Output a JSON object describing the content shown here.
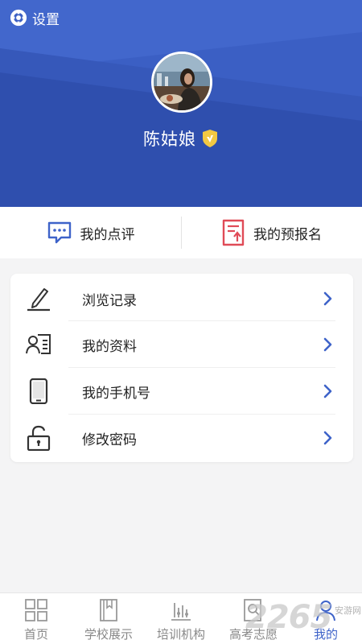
{
  "header": {
    "settings_label": "设置",
    "username": "陈姑娘",
    "colors": {
      "bg": "#3b5fc4",
      "accent": "#f3c843"
    }
  },
  "quick_actions": [
    {
      "label": "我的点评",
      "icon": "comment-icon",
      "color": "#3e63c9"
    },
    {
      "label": "我的预报名",
      "icon": "registration-doc-icon",
      "color": "#e04b57"
    }
  ],
  "menu": [
    {
      "label": "浏览记录",
      "icon": "pencil-icon"
    },
    {
      "label": "我的资料",
      "icon": "profile-card-icon"
    },
    {
      "label": "我的手机号",
      "icon": "phone-icon"
    },
    {
      "label": "修改密码",
      "icon": "lock-icon"
    }
  ],
  "tabs": [
    {
      "label": "首页",
      "icon": "grid-home-icon",
      "active": false
    },
    {
      "label": "学校展示",
      "icon": "book-icon",
      "active": false
    },
    {
      "label": "培训机构",
      "icon": "bar-chart-icon",
      "active": false
    },
    {
      "label": "高考志愿",
      "icon": "search-doc-icon",
      "active": false
    },
    {
      "label": "我的",
      "icon": "user-icon",
      "active": true
    }
  ],
  "watermark": {
    "text": "2265",
    "sub": "安游网"
  },
  "theme": {
    "primary": "#3e63c9",
    "text": "#222222",
    "muted": "#888888"
  }
}
